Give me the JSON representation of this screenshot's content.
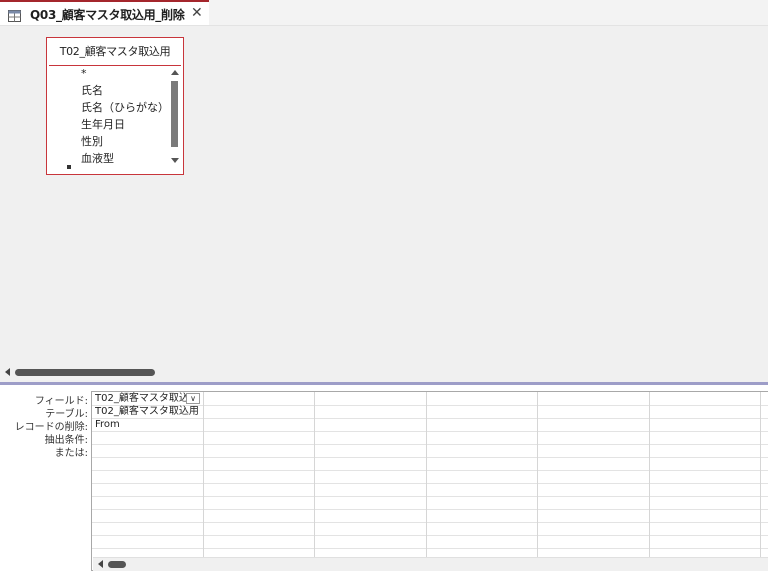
{
  "tab": {
    "title": "Q03_顧客マスタ取込用_削除",
    "close": "✕",
    "icon": "query-icon"
  },
  "field_list": {
    "table_name": "T02_顧客マスタ取込用",
    "fields": [
      "*",
      "氏名",
      "氏名（ひらがな）",
      "生年月日",
      "性別",
      "血液型"
    ]
  },
  "design_grid": {
    "row_labels": [
      "フィールド:",
      "テーブル:",
      "レコードの削除:",
      "抽出条件:",
      "または:"
    ],
    "column1": {
      "field": "T02_顧客マスタ取込",
      "table": "T02_顧客マスタ取込用",
      "delete": "From"
    },
    "dropdown_glyph": "∨"
  },
  "colors": {
    "accent": "#a4262c",
    "splitter": "#9d9dc8"
  }
}
